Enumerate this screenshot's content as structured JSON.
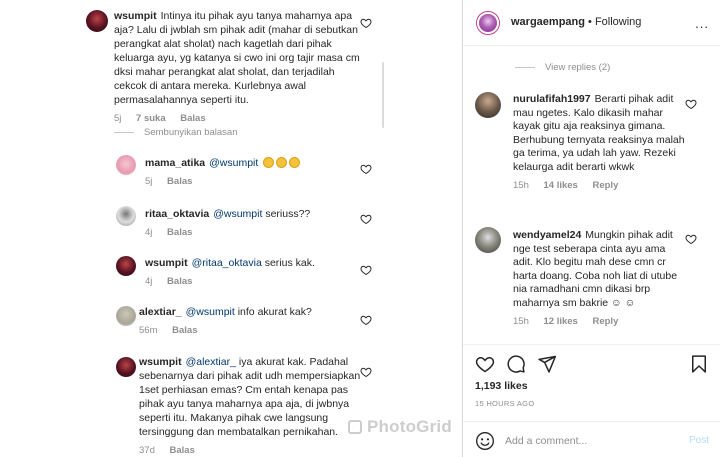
{
  "left_panel": {
    "comments": [
      {
        "username": "wsumpit",
        "text": "Intinya itu pihak ayu tanya maharnya apa aja? Lalu di jwblah sm pihak adit (mahar di sebutkan perangkat alat sholat) nach kagetlah dari pihak keluarga ayu, yg katanya si cwo ini org tajir masa cm dksi mahar perangkat alat sholat, dan terjadilah cekcok di antara mereka. Kurlebnya awal permasalahannya seperti itu.",
        "time": "5j",
        "likes": "7 suka",
        "reply": "Balas"
      }
    ],
    "hide_replies": "Sembunyikan balasan",
    "replies": [
      {
        "username": "mama_atika",
        "mention": "@wsumpit",
        "text": "",
        "time": "5j",
        "reply": "Balas"
      },
      {
        "username": "ritaa_oktavia",
        "mention": "@wsumpit",
        "text": "seriuss??",
        "time": "4j",
        "reply": "Balas"
      },
      {
        "username": "wsumpit",
        "mention": "@ritaa_oktavia",
        "text": "serius kak.",
        "time": "4j",
        "reply": "Balas"
      },
      {
        "username": "alextiar_",
        "mention": "@wsumpit",
        "text": "info akurat kak?",
        "time": "56m",
        "reply": "Balas"
      },
      {
        "username": "wsumpit",
        "mention": "@alextiar_",
        "text": "iya akurat kak. Padahal sebenarnya dari pihak adit udh mempersiapkan 1set perhiasan emas? Cm entah kenapa pas pihak ayu tanya maharnya apa aja, di jwbnya seperti itu. Makanya pihak cwe langsung tersinggung dan membatalkan pernikahan.",
        "time": "37d",
        "reply": "Balas"
      }
    ],
    "watermark": "PhotoGrid"
  },
  "right_panel": {
    "header": {
      "username": "wargaempang",
      "separator": " • ",
      "follow_status": "Following",
      "more": "..."
    },
    "view_replies": "View replies (2)",
    "comments": [
      {
        "username": "nurulafifah1997",
        "text": "Berarti pihak adit mau ngetes. Kalo dikasih mahar kayak gitu aja reaksinya gimana. Berhubung ternyata reaksinya malah ga terima, ya udah lah yaw. Rezeki kelaurga adit berarti wkwk",
        "time": "15h",
        "likes": "14 likes",
        "reply": "Reply"
      },
      {
        "username": "wendyamel24",
        "text": "Mungkin pihak adit nge test seberapa cinta ayu ama adit. Klo begitu mah dese cmn cr harta doang. Coba noh liat di utube nia ramadhani cmn dikasi brp maharnya sm bakrie ☺ ☺",
        "time": "15h",
        "likes": "12 likes",
        "reply": "Reply"
      }
    ],
    "likes_count": "1,193 likes",
    "time_ago": "15 HOURS AGO",
    "add_comment_placeholder": "Add a comment...",
    "post_label": "Post"
  },
  "colors": {
    "mention": "#00376b",
    "meta": "#8e8e8e",
    "post_disabled": "#b2dffc"
  }
}
